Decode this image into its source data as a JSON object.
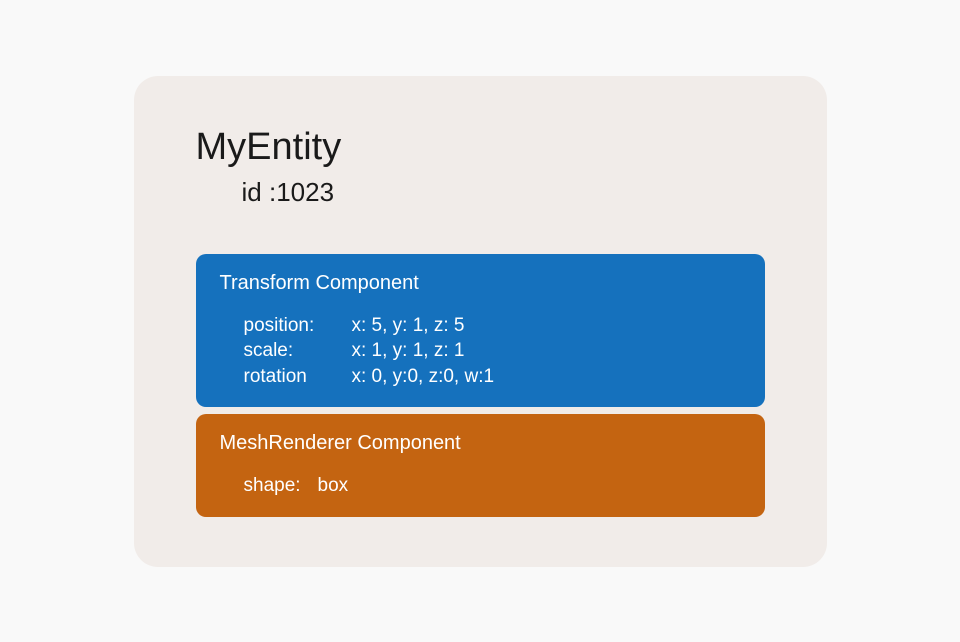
{
  "entity": {
    "name": "MyEntity",
    "id_label": "id :",
    "id_value": "1023"
  },
  "components": {
    "transform": {
      "title": "Transform Component",
      "position": {
        "label": "position:",
        "value": "x: 5, y: 1, z: 5"
      },
      "scale": {
        "label": "scale:",
        "value": "x: 1, y: 1, z: 1"
      },
      "rotation": {
        "label": "rotation",
        "value": "x: 0, y:0, z:0, w:1"
      }
    },
    "meshrenderer": {
      "title": "MeshRenderer Component",
      "shape": {
        "label": "shape:",
        "value": "box"
      }
    }
  }
}
